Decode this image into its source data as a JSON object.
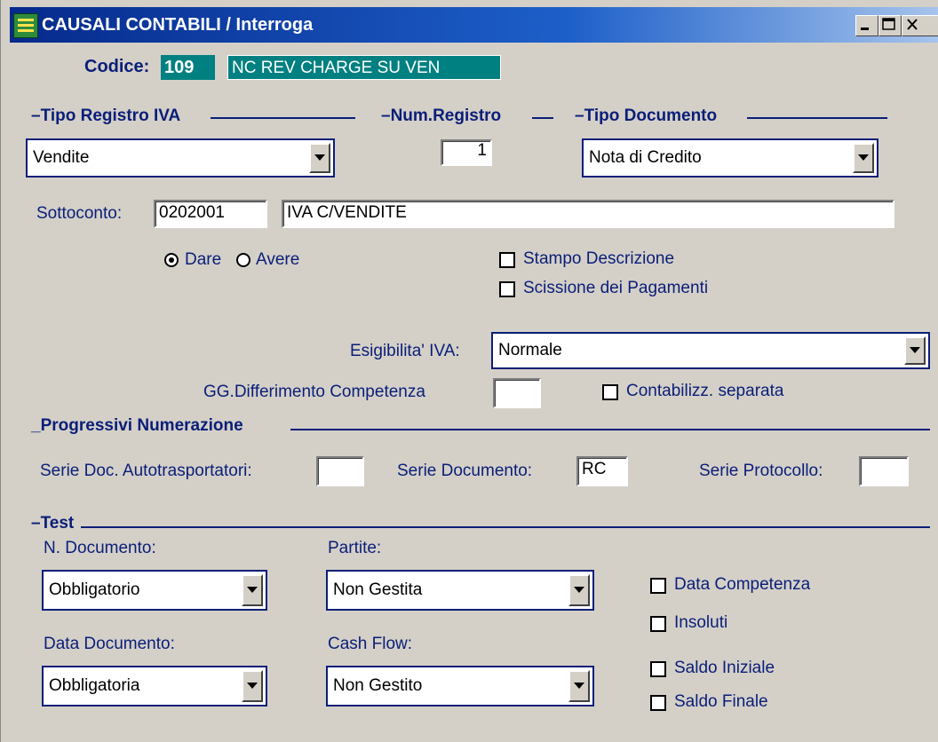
{
  "window": {
    "title": "CAUSALI CONTABILI / Interroga",
    "icon": "ledger-app-icon"
  },
  "header": {
    "codice_label": "Codice:",
    "codice_value": "109",
    "description": "NC REV CHARGE SU VEN"
  },
  "sections": {
    "tipo_registro": "Tipo Registro IVA",
    "num_registro": "Num.Registro",
    "tipo_documento": "Tipo Documento",
    "progressivi": "Progressivi Numerazione",
    "test": "Test"
  },
  "fields": {
    "tipo_registro_value": "Vendite",
    "num_registro_value": "1",
    "tipo_documento_value": "Nota di Credito",
    "sottoconto_label": "Sottoconto:",
    "sottoconto_code": "0202001",
    "sottoconto_desc": "IVA C/VENDITE",
    "dare_label": "Dare",
    "avere_label": "Avere",
    "stampo_label": "Stampo Descrizione",
    "scissione_label": "Scissione dei Pagamenti",
    "esigibilita_label": "Esigibilita' IVA:",
    "esigibilita_value": "Normale",
    "gg_label": "GG.Differimento Competenza",
    "gg_value": "",
    "contab_sep_label": "Contabilizz. separata",
    "serie_auto_label": "Serie Doc. Autotrasportatori:",
    "serie_auto_value": "",
    "serie_doc_label": "Serie Documento:",
    "serie_doc_value": "RC",
    "serie_prot_label": "Serie Protocollo:",
    "serie_prot_value": ""
  },
  "test": {
    "n_documento_label": "N. Documento:",
    "n_documento_value": "Obbligatorio",
    "partite_label": "Partite:",
    "partite_value": "Non Gestita",
    "data_documento_label": "Data Documento:",
    "data_documento_value": "Obbligatoria",
    "cash_flow_label": "Cash Flow:",
    "cash_flow_value": "Non Gestito",
    "data_competenza_label": "Data Competenza",
    "insoluti_label": "Insoluti",
    "saldo_iniziale_label": "Saldo Iniziale",
    "saldo_finale_label": "Saldo Finale"
  },
  "states": {
    "dare_selected": true,
    "stampo_checked": false,
    "scissione_checked": false,
    "contab_sep_checked": false,
    "data_competenza_checked": false,
    "insoluti_checked": false,
    "saldo_iniziale_checked": false,
    "saldo_finale_checked": false
  },
  "colors": {
    "form_bg": "#d4d0c8",
    "section_navy": "#0a1e78",
    "teal": "#008080"
  }
}
